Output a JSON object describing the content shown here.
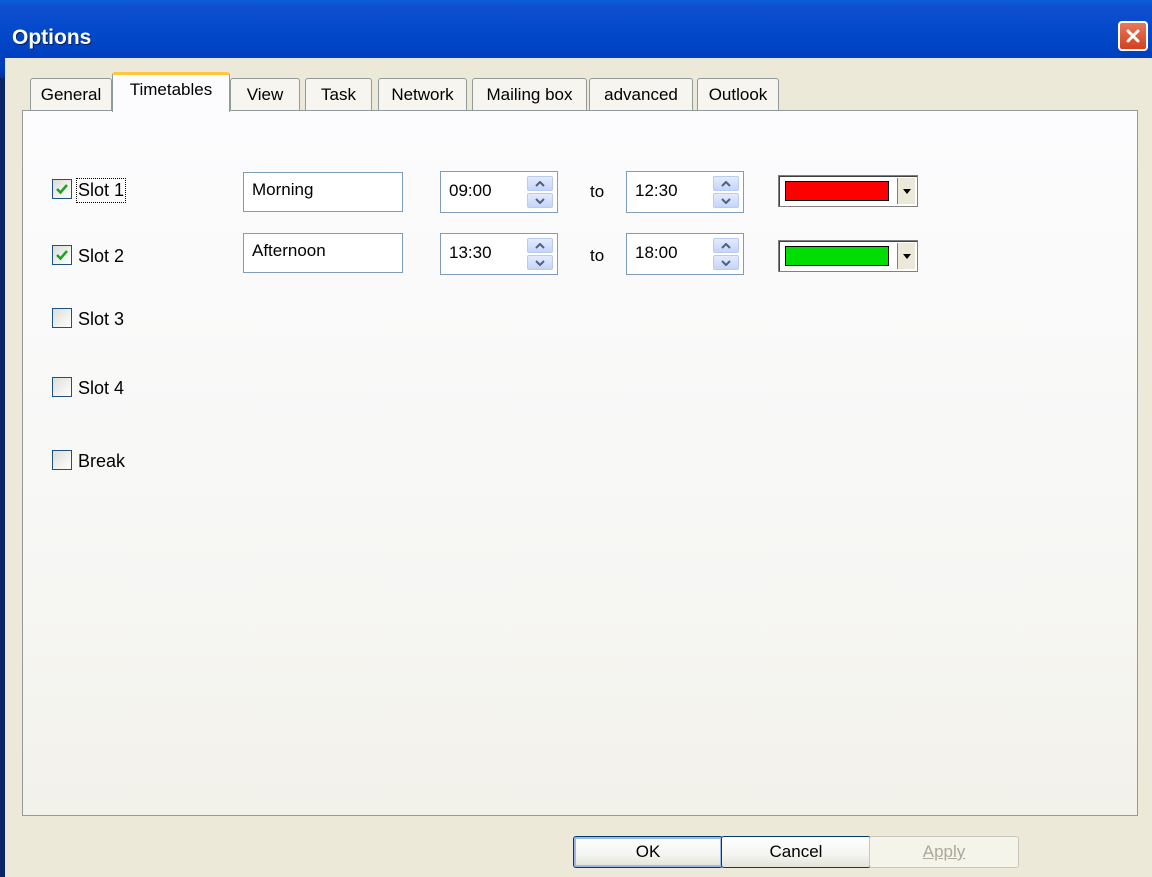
{
  "window": {
    "title": "Options"
  },
  "tabs": [
    {
      "label": "General"
    },
    {
      "label": "Timetables"
    },
    {
      "label": "View"
    },
    {
      "label": "Task"
    },
    {
      "label": "Network"
    },
    {
      "label": "Mailing box"
    },
    {
      "label": "advanced"
    },
    {
      "label": "Outlook"
    }
  ],
  "active_tab": "Timetables",
  "slots": [
    {
      "label": "Slot 1",
      "checked": true,
      "name": "Morning",
      "from": "09:00",
      "to_label": "to",
      "to": "12:30",
      "color": "#ff0000"
    },
    {
      "label": "Slot 2",
      "checked": true,
      "name": "Afternoon",
      "from": "13:30",
      "to_label": "to",
      "to": "18:00",
      "color": "#00dd00"
    },
    {
      "label": "Slot 3",
      "checked": false
    },
    {
      "label": "Slot 4",
      "checked": false
    },
    {
      "label": "Break",
      "checked": false
    }
  ],
  "buttons": {
    "ok": "OK",
    "cancel": "Cancel",
    "apply": "Apply"
  },
  "icons": {
    "close": "close-icon",
    "checkmark": "checkmark-icon",
    "spin_up": "chevron-up-icon",
    "spin_down": "chevron-down-icon",
    "dropdown": "dropdown-arrow-icon"
  },
  "colors": {
    "title_bar": "#0047c8",
    "dialog_face": "#ece9d8",
    "active_tab_accent": "#ffc83c",
    "checkbox_check": "#21a121"
  }
}
